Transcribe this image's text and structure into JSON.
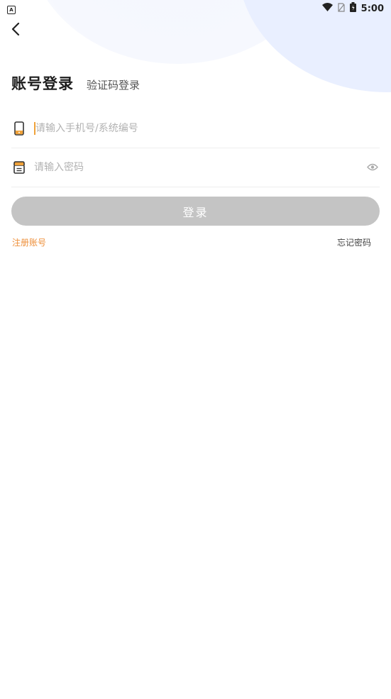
{
  "status_bar": {
    "time": "5:00",
    "app_icon": "A"
  },
  "colors": {
    "accent": "#ee8f3a",
    "button_disabled": "#c4c4c4",
    "bg_blob": "#e9efff"
  },
  "tabs": {
    "active": "账号登录",
    "inactive": "验证码登录"
  },
  "phone_field": {
    "placeholder": "请输入手机号/系统编号",
    "value": ""
  },
  "password_field": {
    "placeholder": "请输入密码",
    "value": ""
  },
  "login_button": {
    "label": "登录"
  },
  "links": {
    "register": "注册账号",
    "forgot": "忘记密码"
  },
  "icons": [
    "back-arrow-icon",
    "phone-icon",
    "lock-icon",
    "eye-icon",
    "wifi-icon",
    "sim-icon",
    "battery-icon"
  ]
}
